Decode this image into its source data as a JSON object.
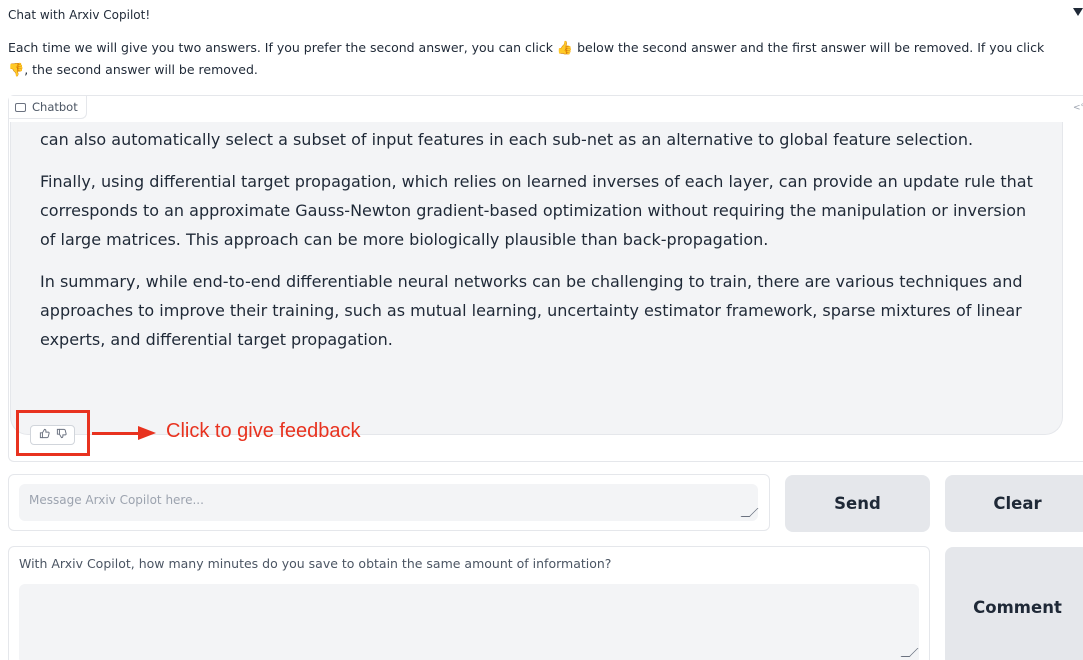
{
  "header": {
    "title": "Chat with Arxiv Copilot!",
    "intro_part1": "Each time we will give you two answers. If you prefer the second answer, you can click ",
    "intro_emoji_up": "👍",
    "intro_part2": " below the second answer and the first answer will be removed. If you click ",
    "intro_emoji_down": "👎",
    "intro_part3": ", the second answer will be removed."
  },
  "chatbot": {
    "label": "Chatbot",
    "paragraphs": [
      "can also automatically select a subset of input features in each sub-net as an alternative to global feature selection.",
      "Finally, using differential target propagation, which relies on learned inverses of each layer, can provide an update rule that corresponds to an approximate Gauss-Newton gradient-based optimization without requiring the manipulation or inversion of large matrices. This approach can be more biologically plausible than back-propagation.",
      "In summary, while end-to-end differentiable neural networks can be challenging to train, there are various techniques and approaches to improve their training, such as mutual learning, uncertainty estimator framework, sparse mixtures of linear experts, and differential target propagation."
    ],
    "like_icon": "thumbs-up-icon",
    "dislike_icon": "thumbs-down-icon"
  },
  "annotation": {
    "text": "Click to give feedback",
    "color": "#e8321f"
  },
  "input": {
    "placeholder": "Message Arxiv Copilot here..."
  },
  "buttons": {
    "send": "Send",
    "clear": "Clear",
    "comment": "Comment"
  },
  "survey": {
    "label": "With Arxiv Copilot, how many minutes do you save to obtain the same amount of information?"
  }
}
